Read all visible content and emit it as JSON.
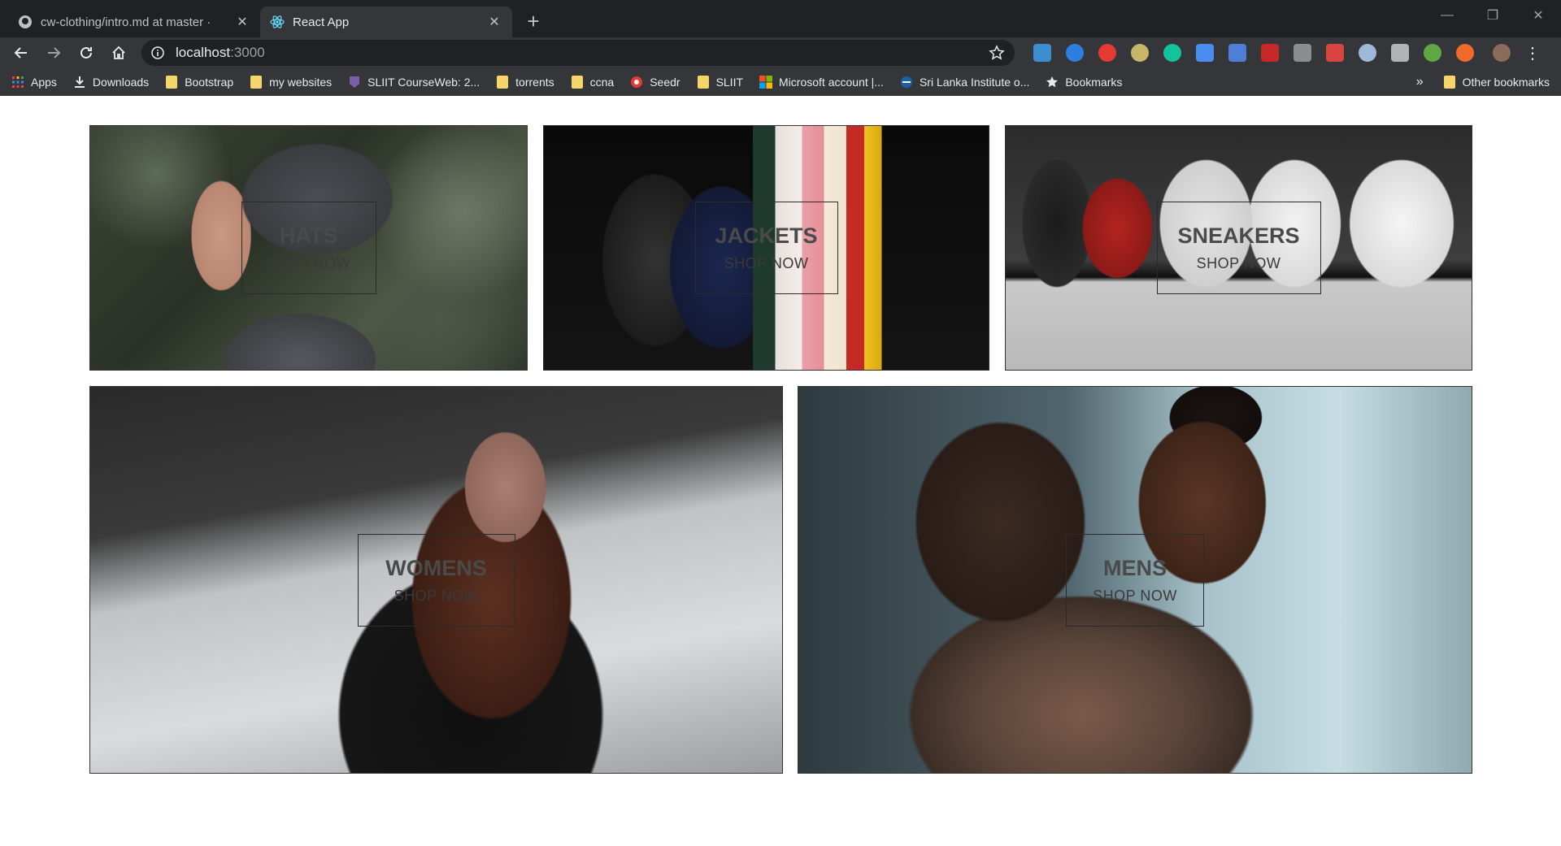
{
  "browser": {
    "tabs": [
      {
        "title": "cw-clothing/intro.md at master ·",
        "favicon": "github-icon",
        "active": false
      },
      {
        "title": "React App",
        "favicon": "react-icon",
        "active": true
      }
    ],
    "address": {
      "host": "localhost",
      "port": ":3000"
    },
    "bookmarks": [
      {
        "label": "Apps",
        "icon": "apps-grid-icon"
      },
      {
        "label": "Downloads",
        "icon": "download-icon"
      },
      {
        "label": "Bootstrap",
        "icon": "folder-icon"
      },
      {
        "label": "my websites",
        "icon": "folder-icon"
      },
      {
        "label": "SLIIT CourseWeb: 2...",
        "icon": "sliit-icon"
      },
      {
        "label": "torrents",
        "icon": "folder-icon"
      },
      {
        "label": "ccna",
        "icon": "folder-icon"
      },
      {
        "label": "Seedr",
        "icon": "seedr-icon"
      },
      {
        "label": "SLIIT",
        "icon": "folder-icon"
      },
      {
        "label": "Microsoft account |...",
        "icon": "microsoft-icon"
      },
      {
        "label": "Sri Lanka Institute o...",
        "icon": "sliit-globe-icon"
      },
      {
        "label": "Bookmarks",
        "icon": "star-icon"
      }
    ],
    "overflow": "»",
    "other_bookmarks": "Other bookmarks",
    "colors": {
      "frame": "#202124",
      "toolbar": "#35363a",
      "text": "#e8eaed"
    }
  },
  "directory": {
    "sections": [
      {
        "title": "HATS",
        "subtitle": "SHOP NOW"
      },
      {
        "title": "JACKETS",
        "subtitle": "SHOP NOW"
      },
      {
        "title": "SNEAKERS",
        "subtitle": "SHOP NOW"
      },
      {
        "title": "WOMENS",
        "subtitle": "SHOP NOW"
      },
      {
        "title": "MENS",
        "subtitle": "SHOP NOW"
      }
    ]
  }
}
